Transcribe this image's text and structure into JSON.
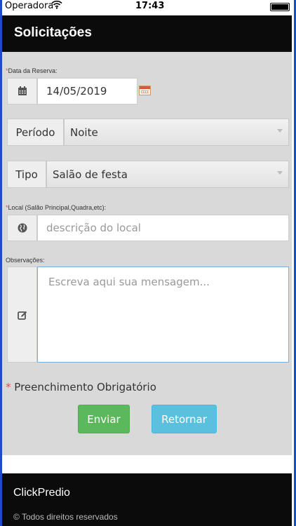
{
  "status_bar": {
    "carrier": "Operadora",
    "time": "17:43"
  },
  "header": {
    "title": "Solicitações"
  },
  "form": {
    "date": {
      "label": "Data da Reserva:",
      "value": "14/05/2019"
    },
    "periodo": {
      "label": "Período",
      "value": "Noite"
    },
    "tipo": {
      "label": "Tipo",
      "value": "Salão de festa"
    },
    "local": {
      "label": "Local (Salão Principal,Quadra,etc):",
      "placeholder": "descrição do local"
    },
    "observacoes": {
      "label": "Observações:",
      "placeholder": "Escreva aqui sua mensagem..."
    },
    "required_note": "Preenchimento Obrigatório",
    "required_marker": "*"
  },
  "buttons": {
    "send": "Enviar",
    "back": "Retornar"
  },
  "footer": {
    "brand": "ClickPredio",
    "copyright": "© Todos direitos reservados"
  },
  "colors": {
    "send": "#5cb85c",
    "back": "#5bc0de",
    "header": "#0b0b0b",
    "panel": "#d9d9d9"
  }
}
